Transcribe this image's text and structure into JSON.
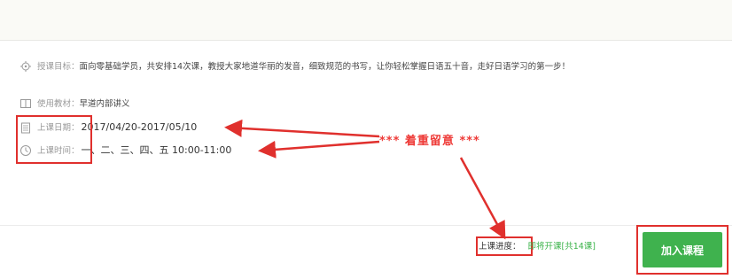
{
  "course": {
    "goal_label": "授课目标：",
    "goal_text": "面向零基础学员，共安排14次课，教授大家地道华丽的发音，细致规范的书写，让你轻松掌握日语五十音，走好日语学习的第一步！",
    "material_label": "使用教材：",
    "material_text": "早道内部讲义",
    "date_label": "上课日期：",
    "date_value": "2017/04/20-2017/05/10",
    "time_label": "上课时间：",
    "time_value": "一、二、三、四、五 10:00-11:00"
  },
  "annotation": {
    "text": "*** 着重留意 ***",
    "color": "#ee3a37"
  },
  "footer": {
    "progress_label": "上课进度：",
    "progress_value": "即将开课[共14课]",
    "join_button": "加入课程"
  },
  "colors": {
    "button_green": "#3fb24e",
    "progress_green": "#3bb34a",
    "annotation_red": "#e0302d"
  },
  "icons": {
    "goal": "target-icon",
    "material": "book-icon",
    "date": "calendar-icon",
    "time": "clock-icon"
  }
}
